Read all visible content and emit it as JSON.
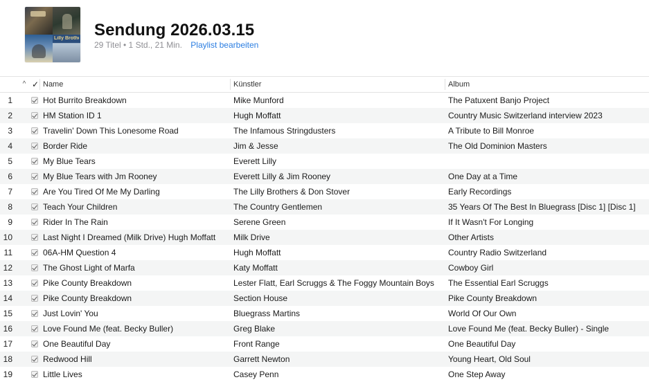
{
  "playlist": {
    "title": "Sendung 2026.03.15",
    "summary": "29 Titel • 1 Std., 21 Min.",
    "edit_label": "Playlist bearbeiten",
    "artwork_text": "Lilly Brothers"
  },
  "columns": {
    "sort_indicator": "^",
    "check": "✓",
    "name": "Name",
    "artist": "Künstler",
    "album": "Album"
  },
  "tracks": [
    {
      "num": "1",
      "name": "Hot Burrito Breakdown",
      "artist": "Mike Munford",
      "album": "The Patuxent Banjo Project"
    },
    {
      "num": "2",
      "name": "HM Station ID 1",
      "artist": "Hugh Moffatt",
      "album": "Country Music Switzerland interview 2023"
    },
    {
      "num": "3",
      "name": "Travelin' Down This Lonesome Road",
      "artist": "The Infamous Stringdusters",
      "album": "A Tribute to Bill Monroe"
    },
    {
      "num": "4",
      "name": "Border Ride",
      "artist": "Jim & Jesse",
      "album": "The Old Dominion Masters"
    },
    {
      "num": "5",
      "name": "My Blue Tears",
      "artist": "Everett Lilly",
      "album": ""
    },
    {
      "num": "6",
      "name": "My Blue Tears with Jm Rooney",
      "artist": "Everett Lilly & Jim Rooney",
      "album": "One Day at a Time"
    },
    {
      "num": "7",
      "name": "Are You Tired Of Me My Darling",
      "artist": "The Lilly Brothers & Don Stover",
      "album": "Early Recordings"
    },
    {
      "num": "8",
      "name": "Teach Your Children",
      "artist": "The Country Gentlemen",
      "album": "35 Years Of The Best In Bluegrass [Disc 1] [Disc 1]"
    },
    {
      "num": "9",
      "name": "Rider In The Rain",
      "artist": "Serene Green",
      "album": "If It Wasn't For Longing"
    },
    {
      "num": "10",
      "name": "Last Night I Dreamed (Milk Drive) Hugh Moffatt",
      "artist": "Milk Drive",
      "album": "Other Artists"
    },
    {
      "num": "11",
      "name": "06A-HM Question 4",
      "artist": "Hugh Moffatt",
      "album": "Country Radio Switzerland"
    },
    {
      "num": "12",
      "name": "The Ghost Light of Marfa",
      "artist": "Katy Moffatt",
      "album": "Cowboy Girl"
    },
    {
      "num": "13",
      "name": "Pike County Breakdown",
      "artist": "Lester Flatt, Earl Scruggs & The Foggy Mountain Boys",
      "album": "The Essential Earl Scruggs"
    },
    {
      "num": "14",
      "name": "Pike County Breakdown",
      "artist": "Section House",
      "album": "Pike County Breakdown"
    },
    {
      "num": "15",
      "name": "Just Lovin' You",
      "artist": "Bluegrass Martins",
      "album": "World Of Our Own"
    },
    {
      "num": "16",
      "name": "Love Found Me (feat. Becky Buller)",
      "artist": "Greg Blake",
      "album": "Love Found Me (feat. Becky Buller) - Single"
    },
    {
      "num": "17",
      "name": "One Beautiful Day",
      "artist": "Front Range",
      "album": "One Beautiful Day"
    },
    {
      "num": "18",
      "name": "Redwood Hill",
      "artist": "Garrett Newton",
      "album": "Young Heart, Old Soul"
    },
    {
      "num": "19",
      "name": "Little Lives",
      "artist": "Casey Penn",
      "album": "One Step Away"
    }
  ]
}
